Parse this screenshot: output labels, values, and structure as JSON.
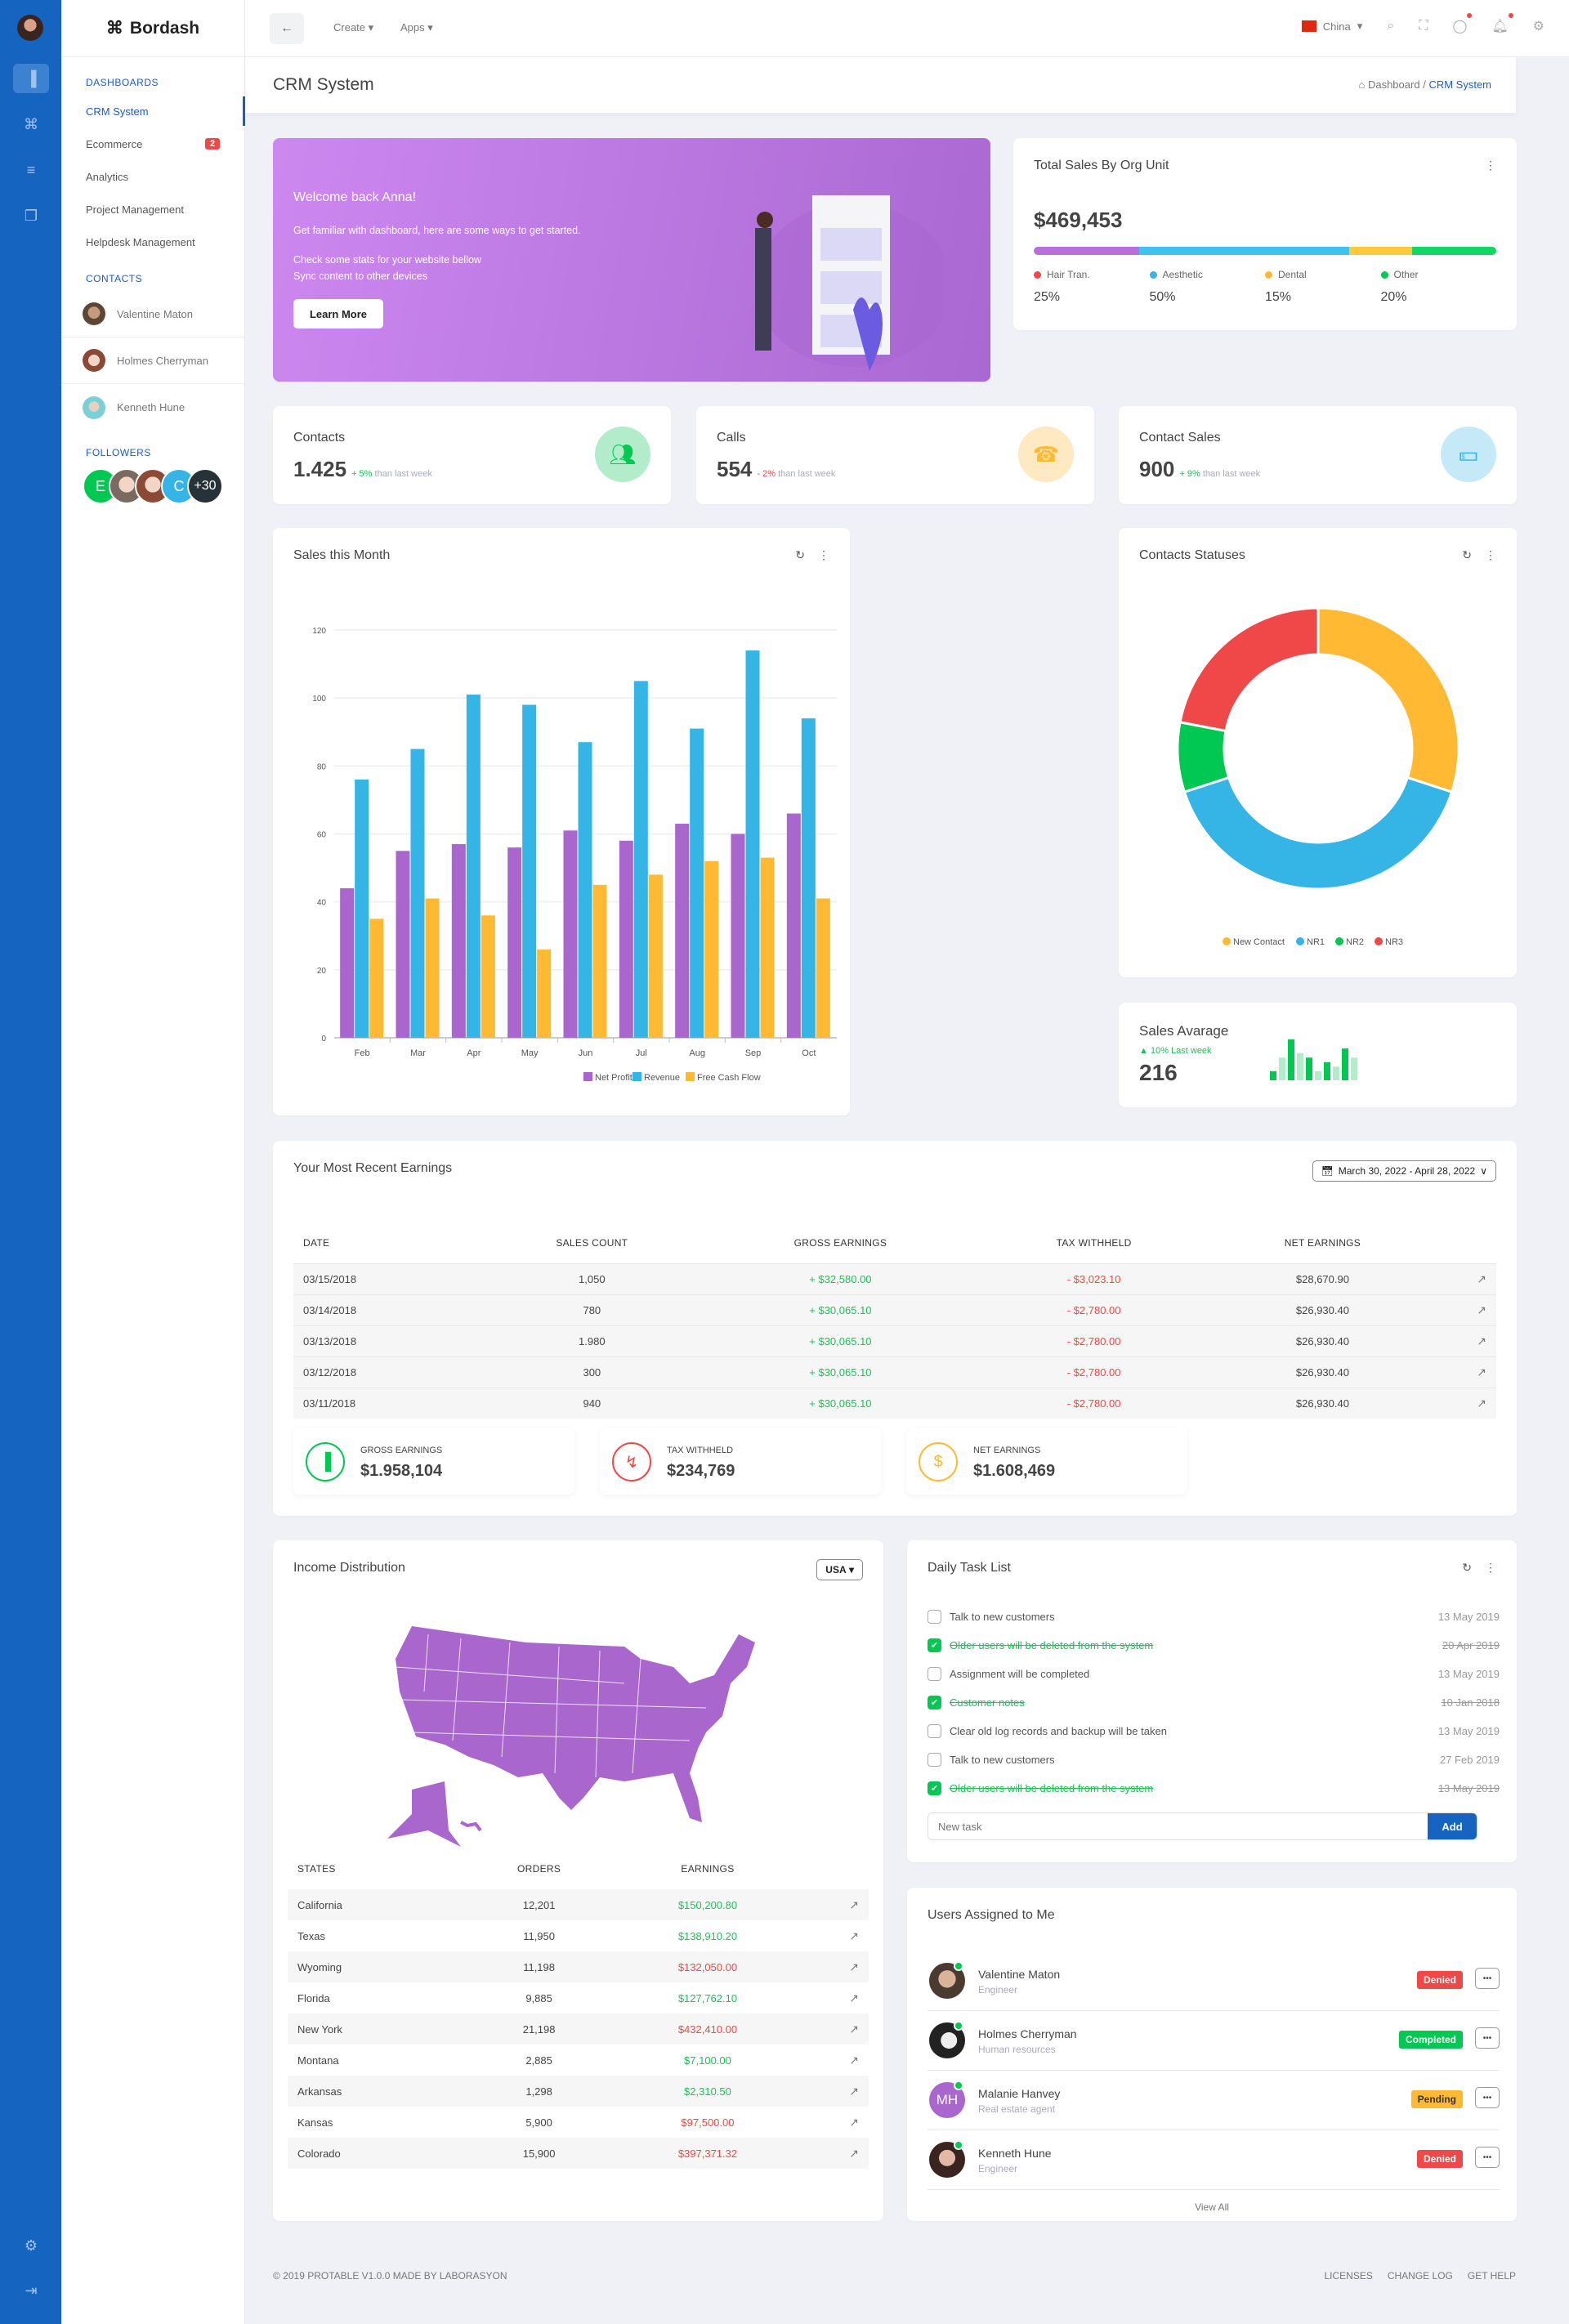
{
  "app": {
    "name": "Bordash"
  },
  "rail": {
    "icons": [
      "chart-icon",
      "command-icon",
      "layers-icon",
      "copy-icon"
    ],
    "bottom_icons": [
      "gear-icon",
      "logout-icon"
    ]
  },
  "sidebar": {
    "dashboards_label": "DASHBOARDS",
    "items": [
      {
        "label": "CRM System",
        "active": true
      },
      {
        "label": "Ecommerce",
        "badge": "2"
      },
      {
        "label": "Analytics"
      },
      {
        "label": "Project Management"
      },
      {
        "label": "Helpdesk Management"
      }
    ],
    "contacts_label": "CONTACTS",
    "contacts": [
      {
        "name": "Valentine Maton"
      },
      {
        "name": "Holmes Cherryman"
      },
      {
        "name": "Kenneth Hune"
      }
    ],
    "followers_label": "FOLLOWERS",
    "followers": [
      "E",
      "",
      "",
      "C",
      "+30"
    ]
  },
  "topbar": {
    "create": "Create",
    "apps": "Apps",
    "country": "China"
  },
  "header": {
    "title": "CRM System",
    "crumb_home": "Dashboard",
    "crumb_sep": "/",
    "crumb_current": "CRM System"
  },
  "welcome": {
    "title": "Welcome back Anna!",
    "line1": "Get familiar with dashboard, here are some ways to get started.",
    "line2": "Check some stats for your website bellow",
    "line3": "Sync content to other devices",
    "button": "Learn More"
  },
  "org_sales": {
    "title": "Total Sales By Org Unit",
    "total": "$469,453",
    "units": [
      {
        "label": "Hair Tran.",
        "pct": "25%",
        "value": 25,
        "dot": "#f04848",
        "bar": "#b86fdc"
      },
      {
        "label": "Aesthetic",
        "pct": "50%",
        "value": 50,
        "dot": "#35b5e5",
        "bar": "#40c2ef"
      },
      {
        "label": "Dental",
        "pct": "15%",
        "value": 15,
        "dot": "#ffb933",
        "bar": "#ffc93c"
      },
      {
        "label": "Other",
        "pct": "20%",
        "value": 20,
        "dot": "#00c853",
        "bar": "#10d860"
      }
    ]
  },
  "stats": [
    {
      "label": "Contacts",
      "value": "1.425",
      "delta": "+ 5%",
      "delta_dir": "up",
      "suffix": "than last week",
      "icon": "users-icon",
      "bg": "#b3eccb",
      "fg": "#00c853"
    },
    {
      "label": "Calls",
      "value": "554",
      "delta": "- 2%",
      "delta_dir": "down",
      "suffix": "than last week",
      "icon": "phone-icon",
      "bg": "#ffe9c2",
      "fg": "#ffb933"
    },
    {
      "label": "Contact Sales",
      "value": "900",
      "delta": "+ 9%",
      "delta_dir": "up",
      "suffix": "than last week",
      "icon": "money-icon",
      "bg": "#c6e9f7",
      "fg": "#35b5e5"
    }
  ],
  "chart_data": [
    {
      "type": "bar",
      "title": "Sales this Month",
      "categories": [
        "Feb",
        "Mar",
        "Apr",
        "May",
        "Jun",
        "Jul",
        "Aug",
        "Sep",
        "Oct"
      ],
      "series": [
        {
          "name": "Net Profit",
          "color": "#a966cc",
          "values": [
            44,
            55,
            57,
            56,
            61,
            58,
            63,
            60,
            66
          ]
        },
        {
          "name": "Revenue",
          "color": "#35b5e5",
          "values": [
            76,
            85,
            101,
            98,
            87,
            105,
            91,
            114,
            94
          ]
        },
        {
          "name": "Free Cash Flow",
          "color": "#ffb933",
          "values": [
            35,
            41,
            36,
            26,
            45,
            48,
            52,
            53,
            41
          ]
        }
      ],
      "yticks": [
        0,
        20,
        40,
        60,
        80,
        100,
        120
      ],
      "ylim": [
        0,
        120
      ],
      "xlabel": "",
      "ylabel": "",
      "legend": "bottom",
      "grid": true
    },
    {
      "type": "pie",
      "title": "Contacts Statuses",
      "donut": true,
      "categories": [
        "New Contact",
        "NR1",
        "NR2",
        "NR3"
      ],
      "values": [
        30,
        40,
        8,
        22
      ],
      "colors": [
        "#ffb933",
        "#35b5e5",
        "#00c853",
        "#f04848"
      ],
      "legend": "bottom"
    },
    {
      "type": "bar",
      "title": "Sales Avarage mini chart",
      "values": [
        2,
        5,
        9,
        6,
        5,
        2,
        4,
        3,
        7,
        5
      ],
      "colors": [
        "#00c853",
        "#b3eccb"
      ]
    }
  ],
  "sales_avg": {
    "title": "Sales Avarage",
    "delta": "10% Last week",
    "value": "216"
  },
  "earnings": {
    "title": "Your Most Recent Earnings",
    "date_range": "March 30, 2022 - April 28, 2022",
    "columns": [
      "DATE",
      "SALES COUNT",
      "GROSS EARNINGS",
      "TAX WITHHELD",
      "NET EARNINGS"
    ],
    "rows": [
      {
        "date": "03/15/2018",
        "count": "1,050",
        "gross": "+ $32,580.00",
        "tax": "- $3,023.10",
        "net": "$28,670.90"
      },
      {
        "date": "03/14/2018",
        "count": "780",
        "gross": "+ $30,065.10",
        "tax": "- $2,780.00",
        "net": "$26,930.40"
      },
      {
        "date": "03/13/2018",
        "count": "1.980",
        "gross": "+ $30,065.10",
        "tax": "- $2,780.00",
        "net": "$26,930.40"
      },
      {
        "date": "03/12/2018",
        "count": "300",
        "gross": "+ $30,065.10",
        "tax": "- $2,780.00",
        "net": "$26,930.40"
      },
      {
        "date": "03/11/2018",
        "count": "940",
        "gross": "+ $30,065.10",
        "tax": "- $2,780.00",
        "net": "$26,930.40"
      }
    ],
    "summary": [
      {
        "label": "GROSS EARNINGS",
        "value": "$1.958,104",
        "color": "#00c853",
        "icon": "bar-chart-icon"
      },
      {
        "label": "TAX WITHHELD",
        "value": "$234,769",
        "color": "#f04848",
        "icon": "receipt-icon"
      },
      {
        "label": "NET EARNINGS",
        "value": "$1.608,469",
        "color": "#ffb933",
        "icon": "dollar-icon"
      }
    ]
  },
  "income": {
    "title": "Income Distribution",
    "region": "USA",
    "map_color": "#a966cc",
    "columns": [
      "STATES",
      "ORDERS",
      "EARNINGS"
    ],
    "rows": [
      {
        "state": "California",
        "orders": "12,201",
        "earn": "$150,200.80",
        "pos": true
      },
      {
        "state": "Texas",
        "orders": "11,950",
        "earn": "$138,910.20",
        "pos": true
      },
      {
        "state": "Wyoming",
        "orders": "11,198",
        "earn": "$132,050.00",
        "pos": false
      },
      {
        "state": "Florida",
        "orders": "9,885",
        "earn": "$127,762.10",
        "pos": true
      },
      {
        "state": "New York",
        "orders": "21,198",
        "earn": "$432,410.00",
        "pos": false
      },
      {
        "state": "Montana",
        "orders": "2,885",
        "earn": "$7,100.00",
        "pos": true
      },
      {
        "state": "Arkansas",
        "orders": "1,298",
        "earn": "$2,310.50",
        "pos": true
      },
      {
        "state": "Kansas",
        "orders": "5,900",
        "earn": "$97,500.00",
        "pos": false
      },
      {
        "state": "Colorado",
        "orders": "15,900",
        "earn": "$397,371.32",
        "pos": false
      }
    ]
  },
  "tasks": {
    "title": "Daily Task List",
    "items": [
      {
        "text": "Talk to new customers",
        "date": "13 May 2019",
        "done": false
      },
      {
        "text": "Older users will be deleted from the system",
        "date": "20 Apr 2019",
        "done": true
      },
      {
        "text": "Assignment will be completed",
        "date": "13 May 2019",
        "done": false
      },
      {
        "text": "Customer notes",
        "date": "10 Jan 2018",
        "done": true
      },
      {
        "text": "Clear old log records and backup will be taken",
        "date": "13 May 2019",
        "done": false
      },
      {
        "text": "Talk to new customers",
        "date": "27 Feb 2019",
        "done": false
      },
      {
        "text": "Older users will be deleted from the system",
        "date": "13 May 2019",
        "done": true
      }
    ],
    "placeholder": "New task",
    "add_label": "Add"
  },
  "users": {
    "title": "Users Assigned to Me",
    "items": [
      {
        "name": "Valentine Maton",
        "role": "Engineer",
        "status": "Denied",
        "color": "#f04848"
      },
      {
        "name": "Holmes Cherryman",
        "role": "Human resources",
        "status": "Completed",
        "color": "#00c853"
      },
      {
        "name": "Malanie Hanvey",
        "role": "Real estate agent",
        "status": "Pending",
        "color": "#ffb933",
        "initials": "MH"
      },
      {
        "name": "Kenneth Hune",
        "role": "Engineer",
        "status": "Denied",
        "color": "#f04848"
      }
    ],
    "view_all": "View All"
  },
  "footer": {
    "copy": "© 2019 PROTABLE V1.0.0 MADE BY LABORASYON",
    "links": [
      "LICENSES",
      "CHANGE LOG",
      "GET HELP"
    ]
  }
}
